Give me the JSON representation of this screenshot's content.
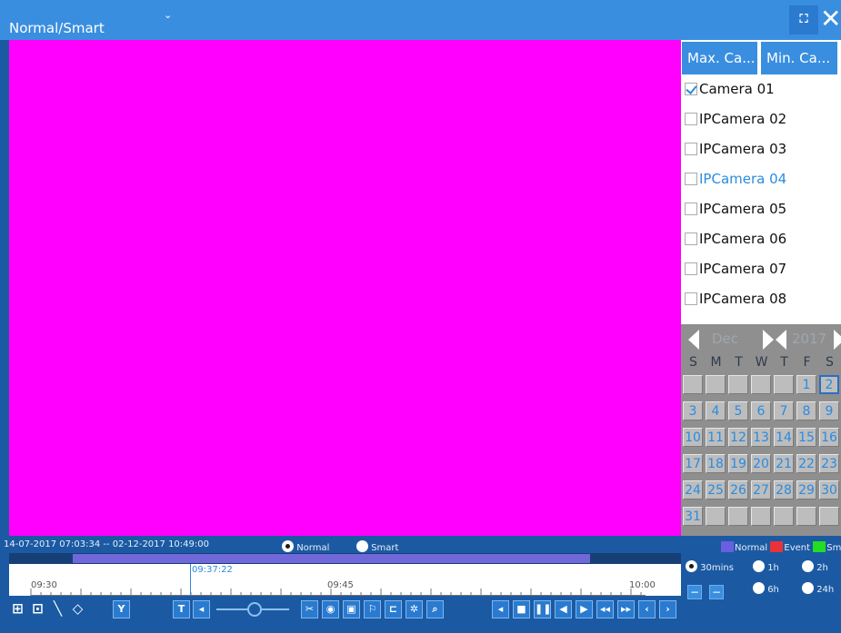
{
  "header": {
    "mode_label": "Normal/Smart",
    "chevron": "⌄",
    "fullscreen_icon": "expand-icon",
    "fullscreen_glyph": "⛶",
    "close_icon": "close-icon",
    "close_glyph": "✕"
  },
  "right_panel": {
    "max_camera_label": "Max. Ca...",
    "min_camera_label": "Min. Ca...",
    "cameras": [
      {
        "label": "Camera 01",
        "checked": true,
        "selected": false
      },
      {
        "label": "IPCamera 02",
        "checked": false,
        "selected": false
      },
      {
        "label": "IPCamera 03",
        "checked": false,
        "selected": false
      },
      {
        "label": "IPCamera 04",
        "checked": false,
        "selected": true
      },
      {
        "label": "IPCamera 05",
        "checked": false,
        "selected": false
      },
      {
        "label": "IPCamera 06",
        "checked": false,
        "selected": false
      },
      {
        "label": "IPCamera 07",
        "checked": false,
        "selected": false
      },
      {
        "label": "IPCamera 08",
        "checked": false,
        "selected": false
      }
    ],
    "calendar": {
      "month": "Dec",
      "year": "2017",
      "weekdays": [
        "S",
        "M",
        "T",
        "W",
        "T",
        "F",
        "S"
      ],
      "highlight_day": "2",
      "rows": [
        [
          "",
          "",
          "",
          "",
          "",
          "1",
          "2"
        ],
        [
          "3",
          "4",
          "5",
          "6",
          "7",
          "8",
          "9"
        ],
        [
          "10",
          "11",
          "12",
          "13",
          "14",
          "15",
          "16"
        ],
        [
          "17",
          "18",
          "19",
          "20",
          "21",
          "22",
          "23"
        ],
        [
          "24",
          "25",
          "26",
          "27",
          "28",
          "29",
          "30"
        ],
        [
          "31",
          "",
          "",
          "",
          "",
          "",
          ""
        ]
      ]
    }
  },
  "bottom": {
    "range_text": "14-07-2017 07:03:34 -- 02-12-2017 10:49:00",
    "playback_mode": {
      "normal_label": "Normal",
      "smart_label": "Smart",
      "selected": "Normal"
    },
    "legend": [
      {
        "label": "Normal",
        "color": "#6a5fe0"
      },
      {
        "label": "Event",
        "color": "#e8333a"
      },
      {
        "label": "Sma",
        "color": "#22dd22"
      }
    ],
    "scale_options": [
      {
        "label": "30mins",
        "selected": true
      },
      {
        "label": "1h",
        "selected": false
      },
      {
        "label": "2h",
        "selected": false
      },
      {
        "label": "6h",
        "selected": false
      },
      {
        "label": "24h",
        "selected": false
      }
    ],
    "zoom_in_glyph": "−",
    "zoom_out_glyph": "−",
    "timeline": {
      "labels": [
        "09:30",
        "09:45",
        "10:00"
      ],
      "cursor_time": "09:37:22"
    },
    "toolbar": {
      "left_tools": [
        {
          "name": "grid-layout-icon",
          "glyph": "⊞"
        },
        {
          "name": "area-select-icon",
          "glyph": "⊡"
        },
        {
          "name": "line-draw-icon",
          "glyph": "╲"
        },
        {
          "name": "polygon-draw-icon",
          "glyph": "◇"
        },
        {
          "name": "filter-icon",
          "glyph": "Y"
        }
      ],
      "mid_tools": [
        {
          "name": "text-overlay-icon",
          "glyph": "T"
        },
        {
          "name": "volume-icon",
          "glyph": "◂"
        }
      ],
      "edit_tools": [
        {
          "name": "clip-icon",
          "glyph": "✂"
        },
        {
          "name": "snapshot-icon",
          "glyph": "◉"
        },
        {
          "name": "lock-file-icon",
          "glyph": "▣"
        },
        {
          "name": "tag-icon",
          "glyph": "⚐"
        },
        {
          "name": "custom-tag-icon",
          "glyph": "⊏"
        },
        {
          "name": "settings-icon",
          "glyph": "✲"
        },
        {
          "name": "digital-zoom-icon",
          "glyph": "⌕"
        }
      ],
      "playback_controls": [
        {
          "name": "reverse-play-icon",
          "glyph": "◂"
        },
        {
          "name": "stop-icon",
          "glyph": "■"
        },
        {
          "name": "pause-icon",
          "glyph": "❚❚"
        },
        {
          "name": "back-30s-icon",
          "glyph": "◀"
        },
        {
          "name": "forward-30s-icon",
          "glyph": "▶"
        },
        {
          "name": "slow-icon",
          "glyph": "◂◂"
        },
        {
          "name": "fast-icon",
          "glyph": "▸▸"
        },
        {
          "name": "previous-day-icon",
          "glyph": "‹"
        },
        {
          "name": "next-day-icon",
          "glyph": "›"
        }
      ]
    }
  }
}
